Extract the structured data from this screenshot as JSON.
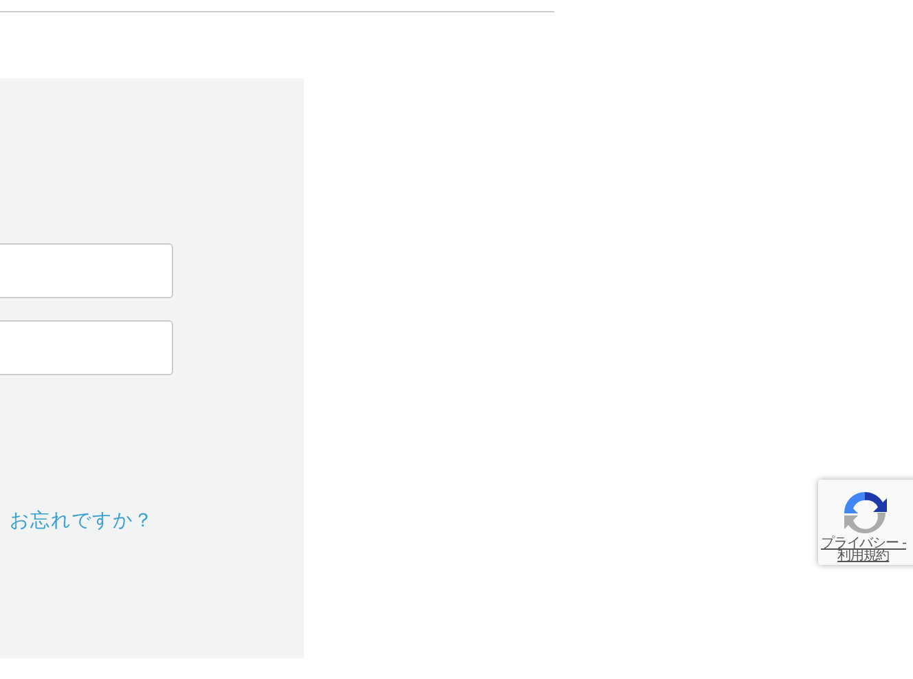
{
  "login_panel": {
    "fields": [
      {
        "kind": "input"
      },
      {
        "kind": "input"
      }
    ],
    "forgot_link": "お忘れですか？"
  },
  "recaptcha_badge": {
    "privacy_link": "プライバシー -",
    "terms_link": "利用規約"
  }
}
